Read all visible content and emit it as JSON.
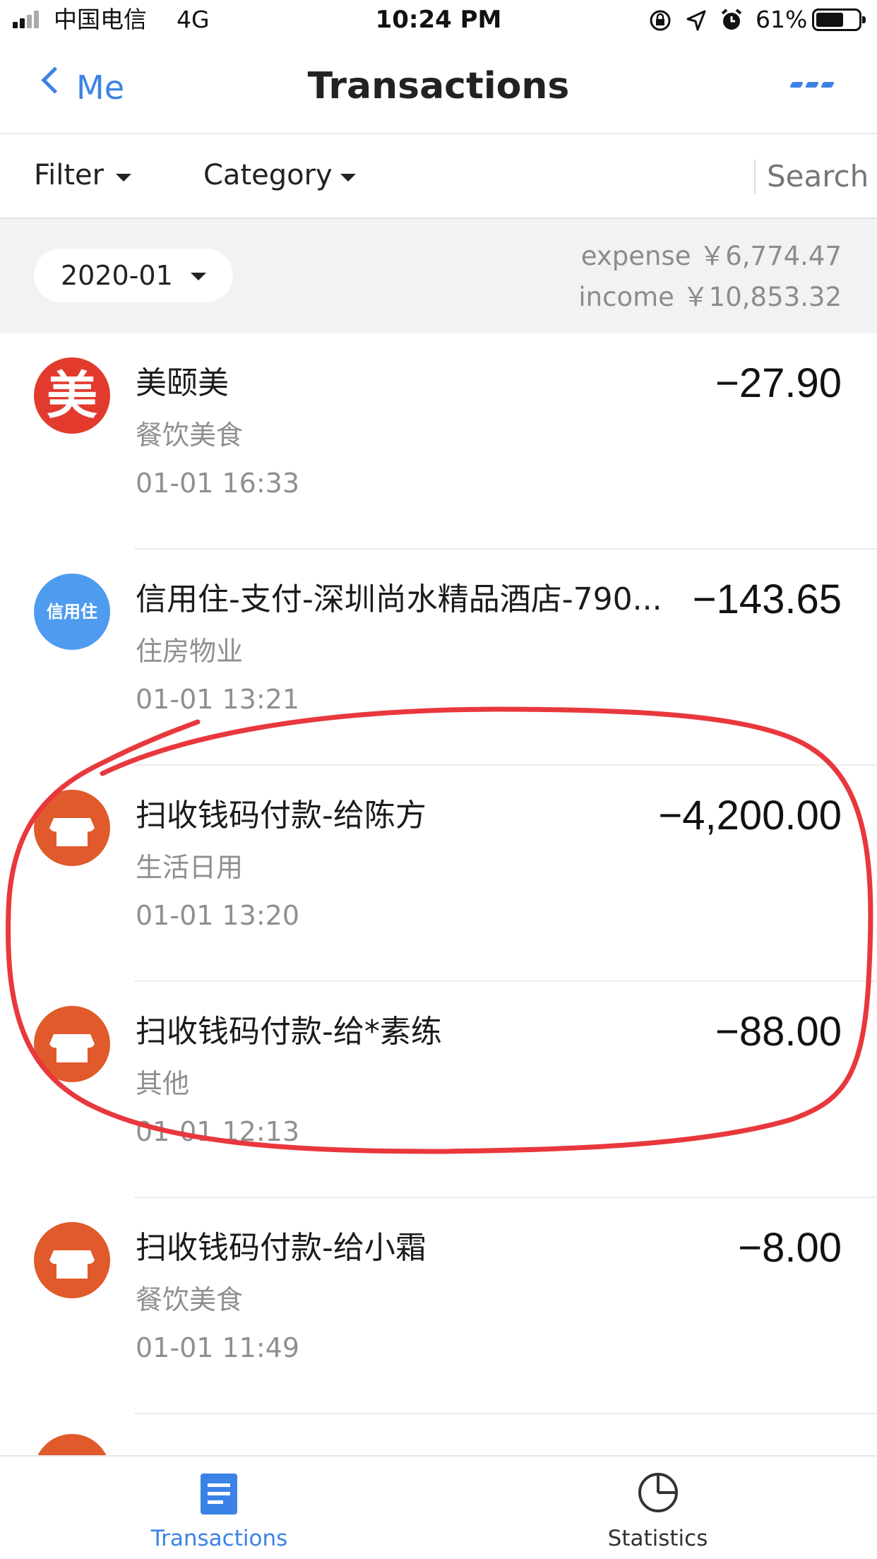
{
  "status_bar": {
    "carrier": "中国电信",
    "network": "4G",
    "time": "10:24 PM",
    "battery": "61%"
  },
  "nav": {
    "back_label": "Me",
    "title": "Transactions"
  },
  "filter_bar": {
    "filter_label": "Filter",
    "category_label": "Category",
    "search_label": "Search"
  },
  "summary": {
    "month": "2020-01",
    "expense": "expense ￥6,774.47",
    "income": "income ￥10,853.32"
  },
  "transactions": [
    {
      "title": "美颐美",
      "category": "餐饮美食",
      "time": "01-01  16:33",
      "amount": "−27.90",
      "avatar_icon": "meiyimei-logo-icon",
      "avatar_text": "美",
      "avatar_color": "#e23b2e"
    },
    {
      "title": "信用住-支付-深圳尚水精品酒店-790...",
      "category": "住房物业",
      "time": "01-01  13:21",
      "amount": "−143.65",
      "avatar_icon": "credit-stay-logo-icon",
      "avatar_text": "信用住",
      "avatar_color": "#4f9bf0"
    },
    {
      "title": "扫收钱码付款-给陈方",
      "category": "生活日用",
      "time": "01-01  13:20",
      "amount": "−4,200.00",
      "avatar_icon": "shop-icon",
      "avatar_color": "#e05a2b"
    },
    {
      "title": "扫收钱码付款-给*素练",
      "category": "其他",
      "time": "01-01  12:13",
      "amount": "−88.00",
      "avatar_icon": "shop-icon",
      "avatar_color": "#e05a2b"
    },
    {
      "title": "扫收钱码付款-给小霜",
      "category": "餐饮美食",
      "time": "01-01  11:49",
      "amount": "−8.00",
      "avatar_icon": "shop-icon",
      "avatar_color": "#e05a2b"
    }
  ],
  "tabbar": {
    "tabs": [
      {
        "label": "Transactions",
        "icon": "document-list-icon",
        "active": true
      },
      {
        "label": "Statistics",
        "icon": "pie-chart-icon",
        "active": false
      }
    ],
    "active_color": "#3b82e6",
    "inactive_color": "#333333"
  },
  "annotation_color": "#e8383d"
}
